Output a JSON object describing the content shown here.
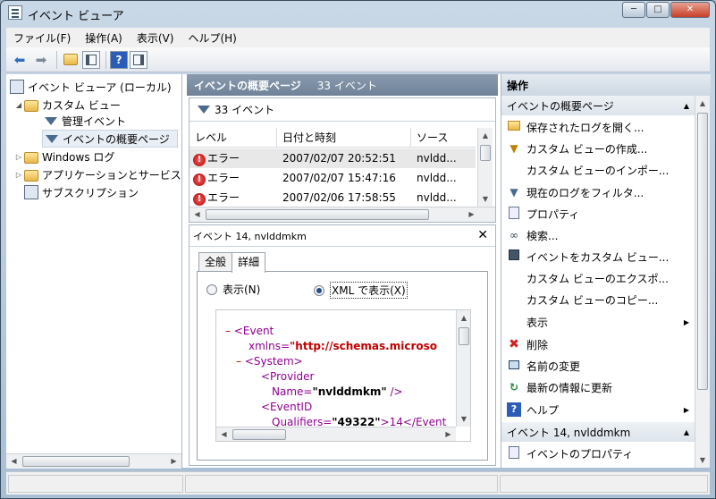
{
  "window": {
    "title": "イベント ビューア",
    "min": "─",
    "max": "□",
    "close": "✕"
  },
  "menu": [
    "ファイル(F)",
    "操作(A)",
    "表示(V)",
    "ヘルプ(H)"
  ],
  "toolbar": {
    "back": "⬅",
    "forward": "➡",
    "help": "?"
  },
  "tree": {
    "root": "イベント ビューア (ローカル)",
    "custom_views": "カスタム ビュー",
    "admin_events": "管理イベント",
    "summary_page": "イベントの概要ページ",
    "windows_logs": "Windows ログ",
    "app_services": "アプリケーションとサービス",
    "subscriptions": "サブスクリプション"
  },
  "middle": {
    "title": "イベントの概要ページ",
    "count": "33 イベント",
    "filter_count": "33 イベント",
    "columns": [
      "レベル",
      "日付と時刻",
      "ソース"
    ],
    "rows": [
      {
        "level": "エラー",
        "datetime": "2007/02/07 20:52:51",
        "source": "nvldd..."
      },
      {
        "level": "エラー",
        "datetime": "2007/02/07 15:47:16",
        "source": "nvldd..."
      },
      {
        "level": "エラー",
        "datetime": "2007/02/06 17:58:55",
        "source": "nvldd..."
      }
    ],
    "detail_title": "イベント 14, nvlddmkm",
    "tabs": [
      "全般",
      "詳細"
    ],
    "radio_display": "表示(N)",
    "radio_xml": "XML で表示(X)",
    "xml": {
      "minus": "–",
      "event_tag": "<Event",
      "xmlns_attr": "xmlns=",
      "xmlns_val": "\"http://schemas.microso",
      "system_tag": "<System>",
      "provider_tag": "<Provider",
      "name_attr": "Name=",
      "name_val": "\"nvlddmkm\"",
      "close_slash": " />",
      "eventid_tag": "<EventID",
      "qual_attr": "Qualifiers=",
      "qual_val": "\"49322\"",
      "qual_rest": ">14</Event"
    }
  },
  "actions": {
    "header": "操作",
    "section1": "イベントの概要ページ",
    "items": [
      "保存されたログを開く...",
      "カスタム ビューの作成...",
      "カスタム ビューのインポー...",
      "現在のログをフィルタ...",
      "プロパティ",
      "検索...",
      "イベントをカスタム ビュー...",
      "カスタム ビューのエクスポ...",
      "カスタム ビューのコピー...",
      "表示",
      "削除",
      "名前の変更",
      "最新の情報に更新",
      "ヘルプ"
    ],
    "section2": "イベント 14, nvlddmkm",
    "item_props": "イベントのプロパティ"
  }
}
